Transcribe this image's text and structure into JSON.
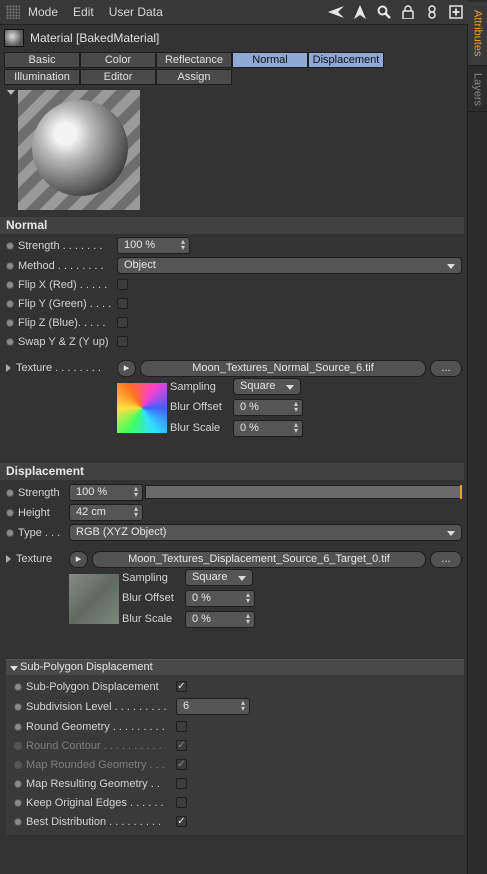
{
  "menubar": {
    "items": [
      "Mode",
      "Edit",
      "User Data"
    ]
  },
  "side_tabs": {
    "attributes": "Attributes",
    "layers": "Layers"
  },
  "material": {
    "title": "Material [BakedMaterial]"
  },
  "tabs": {
    "row1": [
      "Basic",
      "Color",
      "Reflectance",
      "Normal",
      "Displacement"
    ],
    "row2": [
      "Illumination",
      "Editor",
      "Assign"
    ],
    "selected": [
      "Normal",
      "Displacement"
    ]
  },
  "normal": {
    "heading": "Normal",
    "strength_label": "Strength . . . . . . .",
    "strength_value": "100 %",
    "method_label": "Method . . . . . . . .",
    "method_value": "Object",
    "flip_x_label": "Flip X (Red) . . . . .",
    "flip_y_label": "Flip Y (Green) . . . .",
    "flip_z_label": "Flip Z (Blue). . . . .",
    "swap_label": "Swap Y & Z (Y up)",
    "texture_label": "Texture . . . . . . . .",
    "texture_file": "Moon_Textures_Normal_Source_6.tif",
    "more_button": "...",
    "sampling_label": "Sampling",
    "sampling_value": "Square",
    "blur_offset_label": "Blur Offset",
    "blur_offset_value": "0 %",
    "blur_scale_label": "Blur Scale",
    "blur_scale_value": "0 %"
  },
  "displacement": {
    "heading": "Displacement",
    "strength_label": "Strength",
    "strength_value": "100 %",
    "strength_fraction": 1.0,
    "height_label": "Height",
    "height_value": "42 cm",
    "type_label": "Type . . .",
    "type_value": "RGB (XYZ Object)",
    "texture_label": "Texture",
    "texture_file": "Moon_Textures_Displacement_Source_6_Target_0.tif",
    "more_button": "...",
    "sampling_label": "Sampling",
    "sampling_value": "Square",
    "blur_offset_label": "Blur Offset",
    "blur_offset_value": "0 %",
    "blur_scale_label": "Blur Scale",
    "blur_scale_value": "0 %"
  },
  "subpoly": {
    "heading": "Sub-Polygon Displacement",
    "spd_label": "Sub-Polygon Displacement",
    "subdiv_label": "Subdivision Level . . . . . . . . .",
    "subdiv_value": "6",
    "round_geo_label": "Round Geometry . . . . . . . . .",
    "round_contour_label": "Round Contour . . . . . . . . . .",
    "map_rounded_label": "Map Rounded Geometry . . .",
    "map_resulting_label": "Map Resulting Geometry . .",
    "keep_edges_label": "Keep Original Edges . . . . . .",
    "best_dist_label": "Best Distribution . . . . . . . . .",
    "check_mark": "✓"
  },
  "colors": {
    "accent": "#f0a020",
    "tab_selected": "#8fa8d6"
  }
}
